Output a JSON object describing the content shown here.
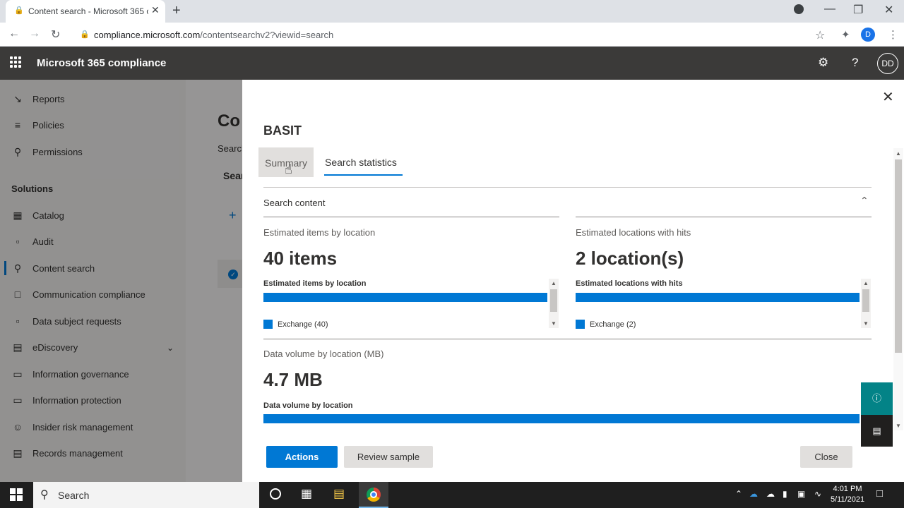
{
  "browser": {
    "tab_title": "Content search - Microsoft 365 c",
    "url_host": "compliance.microsoft.com",
    "url_path": "/contentsearchv2?viewid=search",
    "profile_initial": "D"
  },
  "app": {
    "title": "Microsoft 365 compliance",
    "avatar_initials": "DD"
  },
  "leftnav": {
    "items": [
      {
        "label": "Reports",
        "icon": "chart-line-icon"
      },
      {
        "label": "Policies",
        "icon": "sliders-icon"
      },
      {
        "label": "Permissions",
        "icon": "key-icon"
      },
      {
        "label": "Solutions",
        "section": true
      },
      {
        "label": "Catalog",
        "icon": "grid-icon"
      },
      {
        "label": "Audit",
        "icon": "document-icon"
      },
      {
        "label": "Content search",
        "icon": "search-icon",
        "active": true
      },
      {
        "label": "Communication compliance",
        "icon": "chat-icon"
      },
      {
        "label": "Data subject requests",
        "icon": "document-icon"
      },
      {
        "label": "eDiscovery",
        "icon": "briefcase-icon"
      },
      {
        "label": "Information governance",
        "icon": "lock-icon"
      },
      {
        "label": "Information protection",
        "icon": "lock-icon"
      },
      {
        "label": "Insider risk management",
        "icon": "person-icon"
      },
      {
        "label": "Records management",
        "icon": "records-icon"
      }
    ]
  },
  "background": {
    "title_partial": "Co",
    "subtitle_partial": "Search",
    "tab_partial": "Sear"
  },
  "panel": {
    "title": "BASIT",
    "tabs": [
      "Summary",
      "Search statistics"
    ],
    "active_tab": "Search statistics",
    "section_title": "Search content",
    "items_block": {
      "label": "Estimated items by location",
      "big_value": "40 items",
      "chart_title": "Estimated items by location",
      "legend": "Exchange (40)"
    },
    "locations_block": {
      "label": "Estimated locations with hits",
      "big_value": "2 location(s)",
      "chart_title": "Estimated locations with hits",
      "legend": "Exchange (2)"
    },
    "volume_block": {
      "label": "Data volume by location (MB)",
      "big_value": "4.7 MB",
      "chart_title": "Data volume by location"
    },
    "buttons": {
      "actions": "Actions",
      "review": "Review sample",
      "close": "Close"
    }
  },
  "taskbar": {
    "search_label": "Search",
    "time": "4:01 PM",
    "date": "5/11/2021"
  },
  "colors": {
    "accent": "#0078d4",
    "header": "#3b3a39",
    "help": "#038387"
  }
}
